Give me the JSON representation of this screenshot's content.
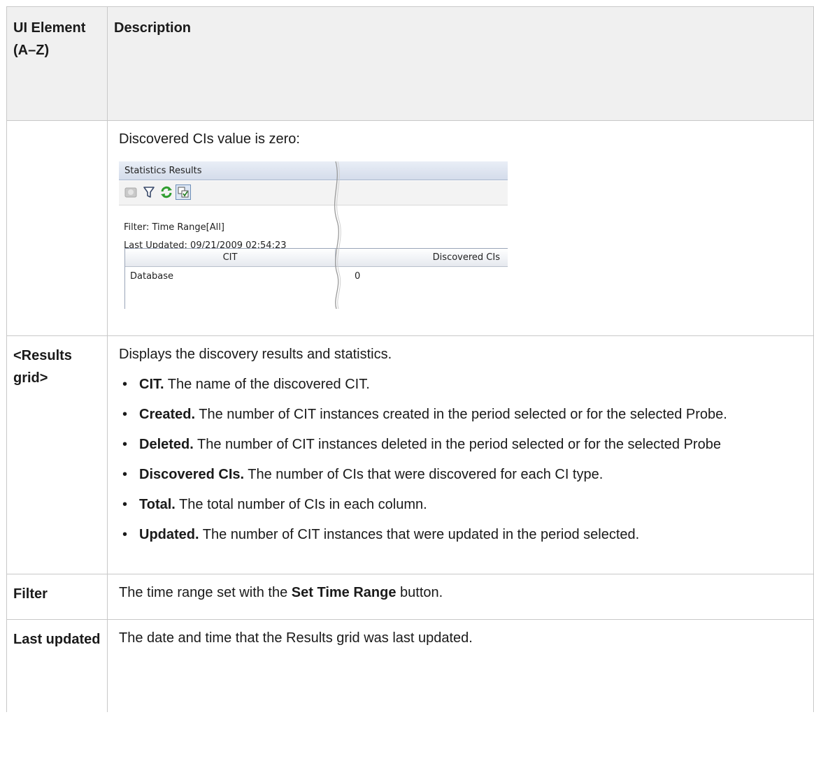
{
  "table": {
    "header": {
      "col1": "UI Element (A–Z)",
      "col2": "Description"
    },
    "rows": [
      {
        "element": "",
        "intro": "Discovered CIs value is zero:"
      },
      {
        "element": "<Results grid>",
        "intro": "Displays the discovery results and statistics.",
        "bullets": [
          {
            "term": "CIT.",
            "text": " The name of the discovered CIT."
          },
          {
            "term": "Created.",
            "text": " The number of CIT instances created in the period selected or for the selected Probe."
          },
          {
            "term": "Deleted.",
            "text": " The number of CIT instances deleted in the period selected or for the selected Probe"
          },
          {
            "term": "Discovered CIs.",
            "text": " The number of CIs that were discovered for each CI type."
          },
          {
            "term": "Total.",
            "text": " The total number of CIs in each column."
          },
          {
            "term": "Updated.",
            "text": " The number of CIT instances that were updated in the period selected."
          }
        ]
      },
      {
        "element": "Filter",
        "pre": "The time range set with the ",
        "bold": "Set Time Range",
        "post": " button."
      },
      {
        "element": "Last updated",
        "intro": "The date and time that the Results grid was last updated."
      }
    ]
  },
  "screenshot": {
    "title": "Statistics Results",
    "toolbar_icons": [
      "statistics-icon",
      "filter-icon",
      "refresh-icon",
      "select-checkbox-icon"
    ],
    "filter_text": "Filter: Time Range[All]",
    "last_updated_text": "Last Updated: 09/21/2009 02:54:23",
    "grid": {
      "columns": [
        "CIT",
        "Discovered CIs"
      ],
      "rows": [
        [
          "Database",
          "0"
        ]
      ]
    }
  }
}
